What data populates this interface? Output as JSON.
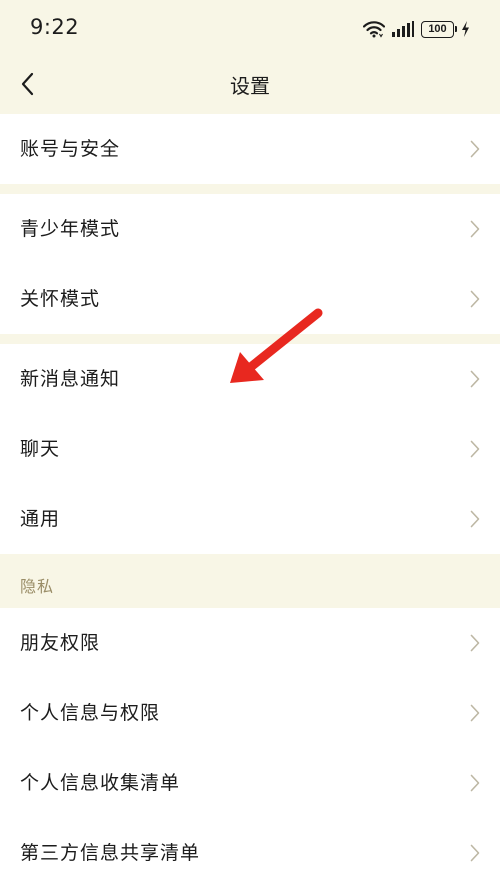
{
  "status": {
    "time": "9:22",
    "battery": "100"
  },
  "header": {
    "title": "设置",
    "back_icon": "chevron-left-icon"
  },
  "groups": [
    {
      "items": [
        {
          "label": "账号与安全"
        }
      ]
    },
    {
      "items": [
        {
          "label": "青少年模式"
        },
        {
          "label": "关怀模式"
        }
      ]
    },
    {
      "items": [
        {
          "label": "新消息通知"
        },
        {
          "label": "聊天"
        },
        {
          "label": "通用"
        }
      ]
    },
    {
      "title": "隐私",
      "items": [
        {
          "label": "朋友权限"
        },
        {
          "label": "个人信息与权限"
        },
        {
          "label": "个人信息收集清单"
        },
        {
          "label": "第三方信息共享清单"
        }
      ]
    }
  ],
  "annotation": {
    "icon": "red-arrow-annotation",
    "color": "#e8281f"
  },
  "colors": {
    "page_background": "#f8f6e6",
    "row_background": "#ffffff",
    "section_label": "#9a8d67",
    "chevron": "#bdb7a4"
  }
}
